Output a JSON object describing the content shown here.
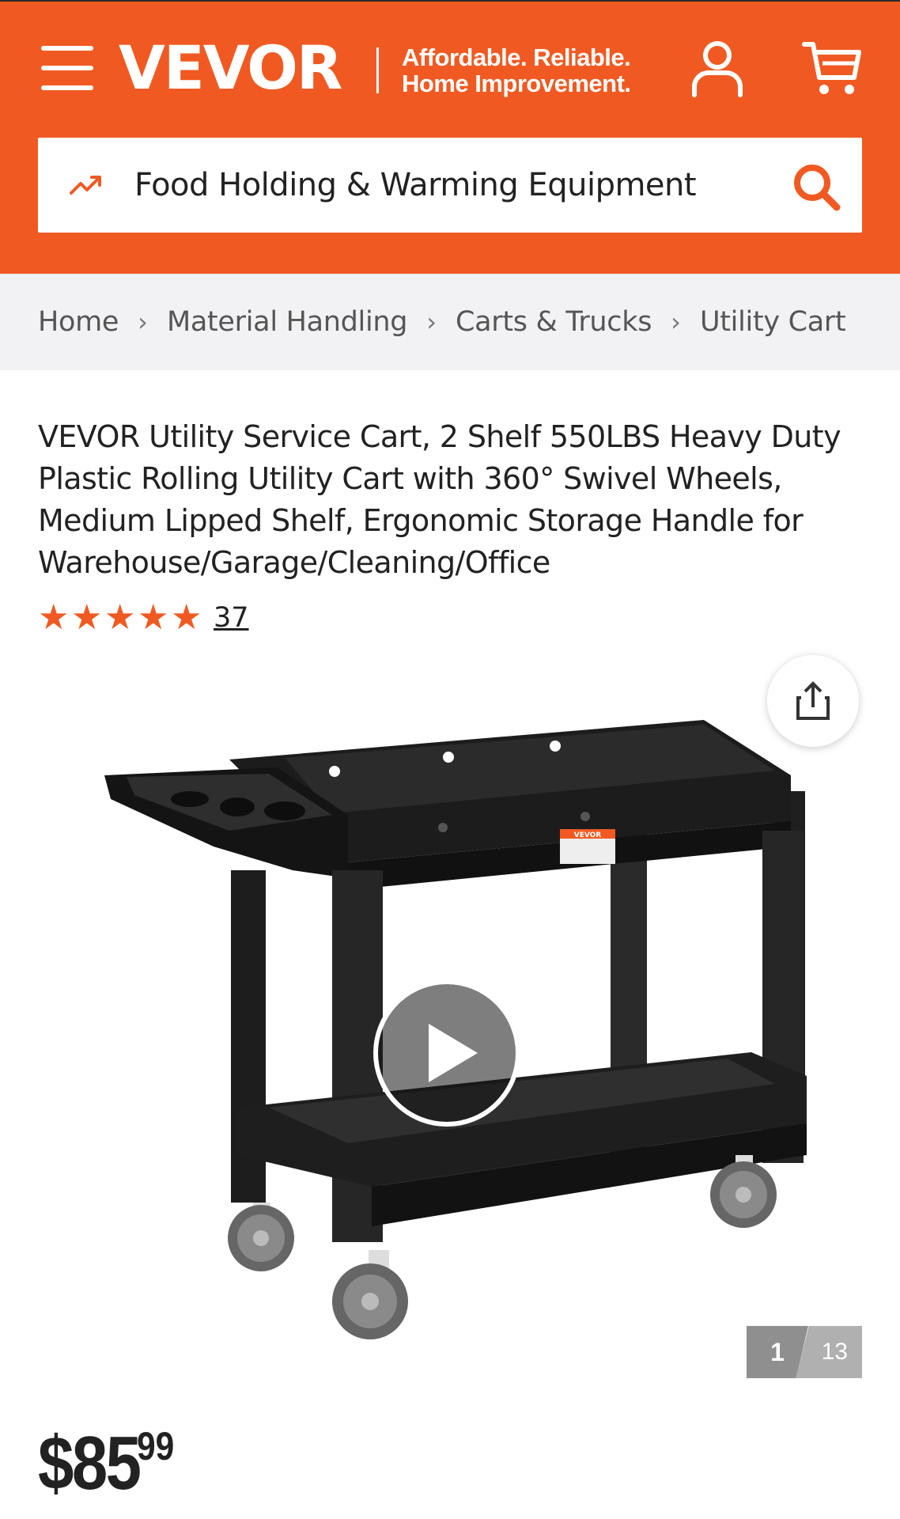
{
  "header": {
    "logo": "VEVOR",
    "tagline_line1": "Affordable. Reliable.",
    "tagline_line2": "Home Improvement.",
    "background_color": "#f05a22",
    "icons": [
      "menu-icon",
      "account-icon",
      "cart-icon"
    ]
  },
  "search": {
    "value": "Food Holding & Warming Equipment",
    "icon": "trending-icon",
    "button_icon": "search-icon"
  },
  "breadcrumb": [
    "Home",
    "Material Handling",
    "Carts & Trucks",
    "Utility Cart"
  ],
  "product": {
    "title": "VEVOR Utility Service Cart, 2 Shelf 550LBS Heavy Duty Plastic Rolling Utility Cart with 360° Swivel Wheels, Medium Lipped Shelf, Ergonomic Storage Handle for Warehouse/Garage/Cleaning/Office",
    "rating_stars": 5,
    "review_count": "37",
    "price_whole": "$85",
    "price_cents": "99",
    "accent_color": "#f05a22",
    "image_label": "VEVOR"
  },
  "gallery": {
    "current": "1",
    "total": "13"
  }
}
